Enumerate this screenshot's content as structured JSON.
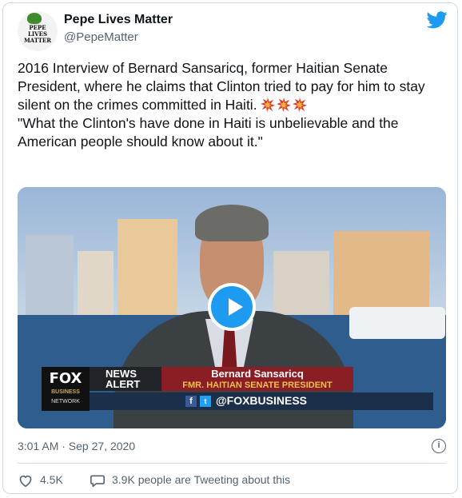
{
  "user": {
    "display_name": "Pepe Lives Matter",
    "handle": "@PepeMatter",
    "avatar_text": [
      "PEPE",
      "LIVES",
      "MATTER"
    ]
  },
  "tweet": {
    "line1": "2016 Interview of Bernard Sansaricq, former Haitian Senate President, where he claims that Clinton tried to pay for him to stay silent on the crimes committed in Haiti.",
    "line2": "\"What the Clinton's have done in Haiti is unbelievable and the American people should know about it.\"",
    "emoji": "collision-icon"
  },
  "video": {
    "network": "FOX",
    "network_sub": "BUSINESS",
    "network_tag": "NETWORK",
    "alert_label": "NEWS ALERT",
    "lower_third_name": "Bernard Sansaricq",
    "lower_third_title": "FMR. HAITIAN SENATE PRESIDENT",
    "social_handle": "@FOXBUSINESS",
    "fb_glyph": "f",
    "tw_glyph": "t"
  },
  "meta": {
    "timestamp": "3:01 AM · Sep 27, 2020",
    "likes": "4.5K",
    "conversation": "3.9K people are Tweeting about this",
    "info_glyph": "i"
  },
  "colors": {
    "accent": "#1d9bf0",
    "muted": "#536471",
    "lower_third_red": "#8b1d24",
    "gold": "#f1c14a"
  }
}
